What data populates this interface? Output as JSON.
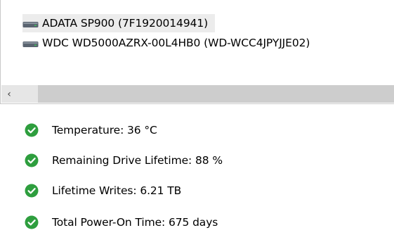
{
  "drives": [
    {
      "label": "ADATA SP900 (7F1920014941)",
      "selected": true,
      "icon": "drive-icon"
    },
    {
      "label": "WDC WD5000AZRX-00L4HB0 (WD-WCC4JPYJJE02)",
      "selected": false,
      "icon": "drive-icon"
    }
  ],
  "scrollbar": {
    "left_arrow": "‹"
  },
  "status": [
    {
      "text": "Temperature: 36 °C",
      "icon": "check-circle-icon"
    },
    {
      "text": "Remaining Drive Lifetime: 88 %",
      "icon": "check-circle-icon"
    },
    {
      "text": "Lifetime Writes: 6.21 TB",
      "icon": "check-circle-icon"
    },
    {
      "text": "Total Power-On Time: 675 days",
      "icon": "check-circle-icon"
    }
  ],
  "colors": {
    "ok_green": "#2e9e3e",
    "selection_bg": "#ececec",
    "scroll_track": "#cdcdcd"
  }
}
